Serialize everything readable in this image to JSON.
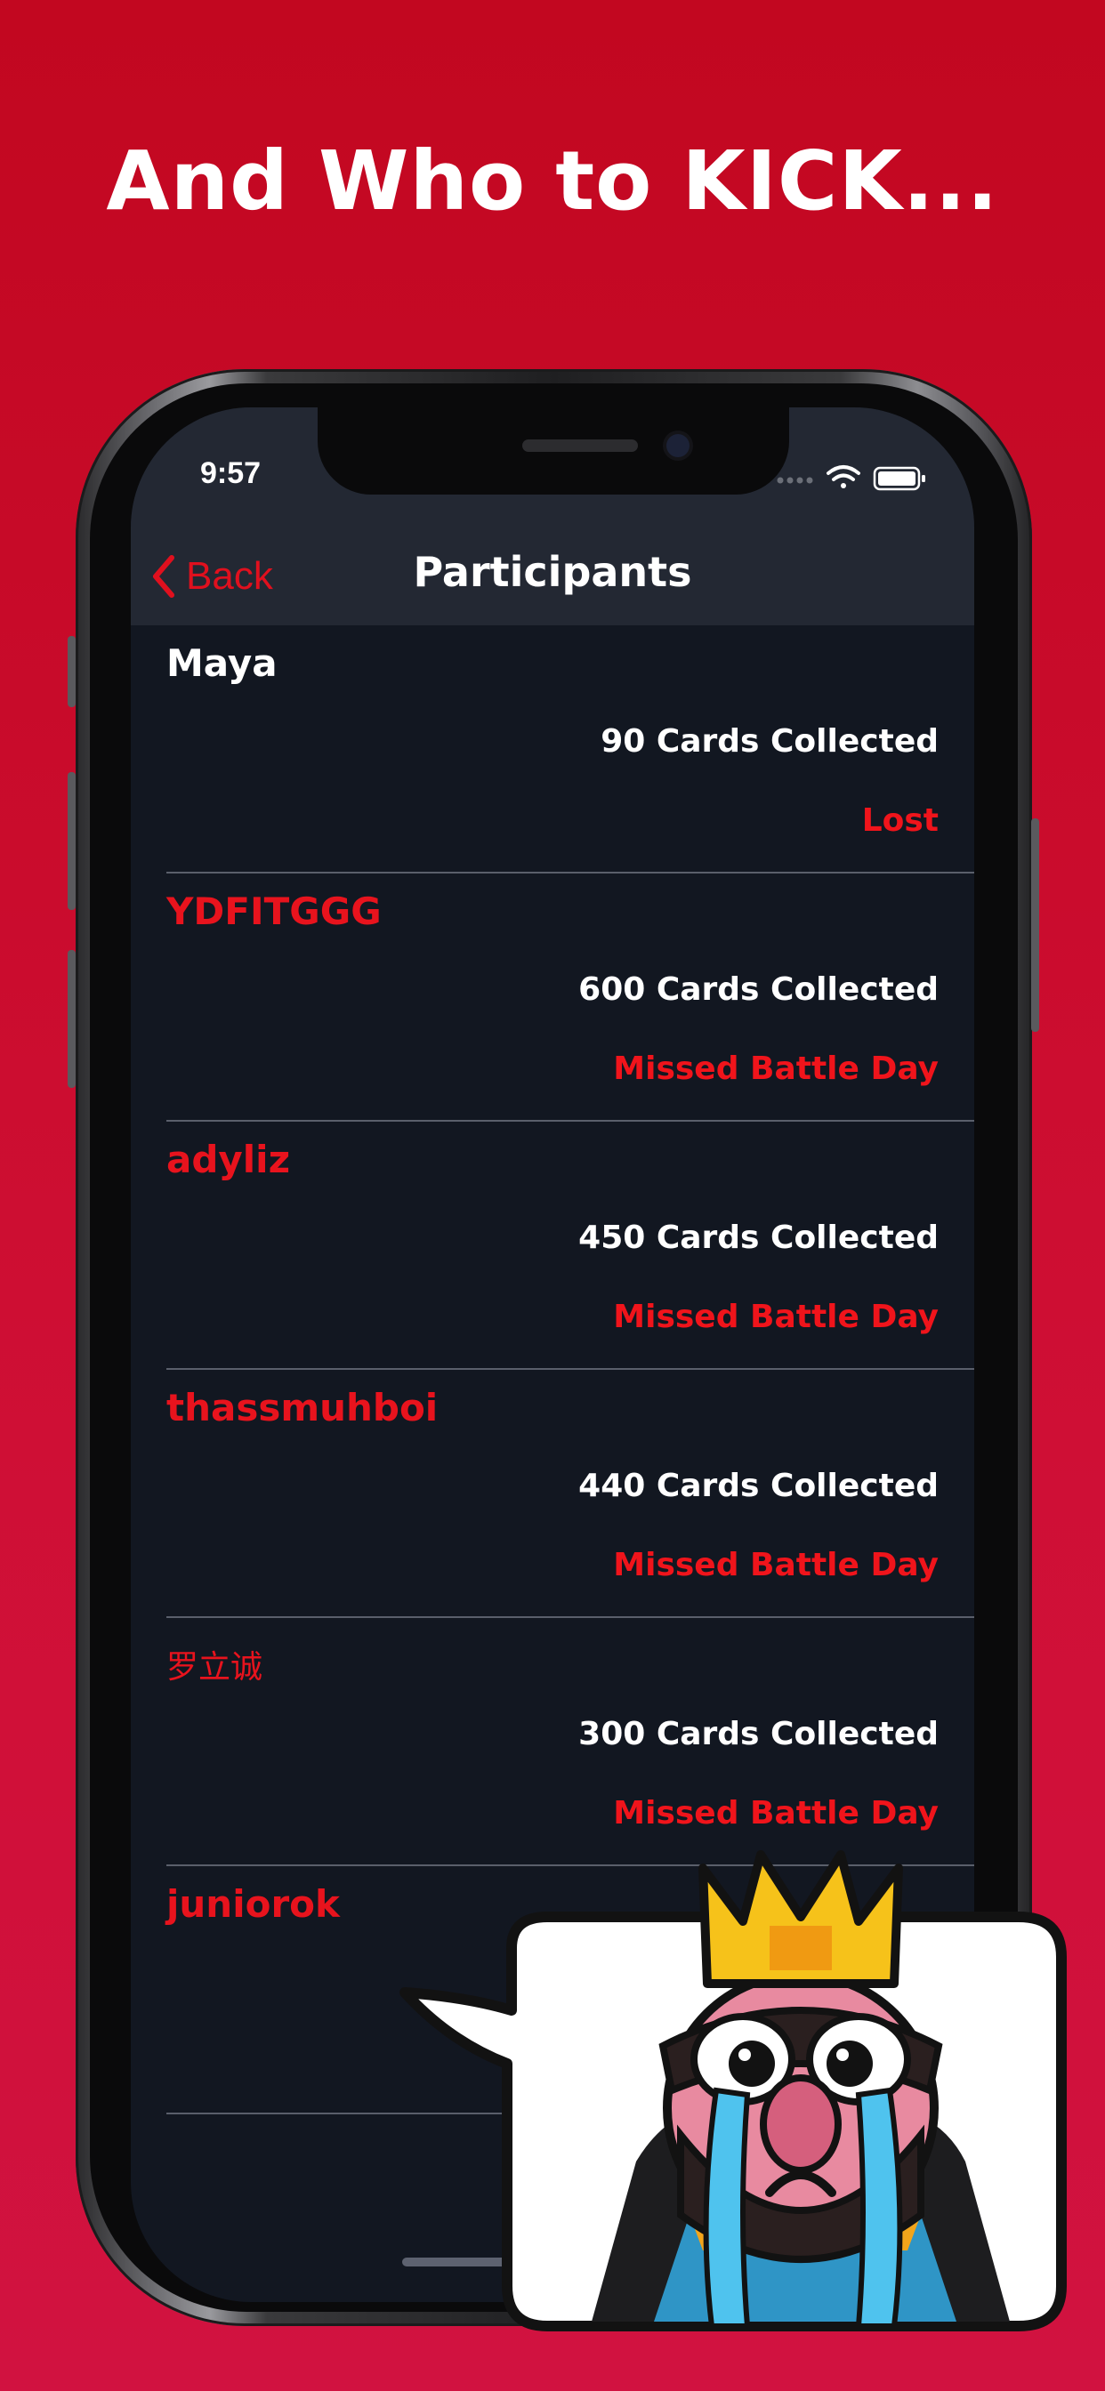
{
  "headline": "And Who to KICK...",
  "status_bar": {
    "time": "9:57"
  },
  "nav": {
    "back_label": "Back",
    "title": "Participants"
  },
  "participants": [
    {
      "name": "Maya",
      "name_color": "#ffffff",
      "cards": "90 Cards Collected",
      "status": "Lost"
    },
    {
      "name": "YDFITGGG",
      "name_color": "#e8131d",
      "cards": "600 Cards Collected",
      "status": "Missed Battle Day"
    },
    {
      "name": "adyliz",
      "name_color": "#e8131d",
      "cards": "450 Cards Collected",
      "status": "Missed Battle Day"
    },
    {
      "name": "thassmuhboi",
      "name_color": "#e8131d",
      "cards": "440 Cards Collected",
      "status": "Missed Battle Day"
    },
    {
      "name": "罗立诚",
      "name_color": "#e8131d",
      "cards": "300 Cards Collected",
      "status": "Missed Battle Day"
    },
    {
      "name": "juniorok",
      "name_color": "#e8131d",
      "cards": "",
      "status": ""
    }
  ],
  "colors": {
    "background": "#c8092a",
    "accent_red": "#e8131d",
    "screen_bg": "#121721",
    "navbar_bg": "#232833"
  },
  "icons": {
    "back": "chevron-left-icon",
    "wifi": "wifi-icon",
    "battery": "battery-icon",
    "signal": "signal-dots-icon"
  }
}
